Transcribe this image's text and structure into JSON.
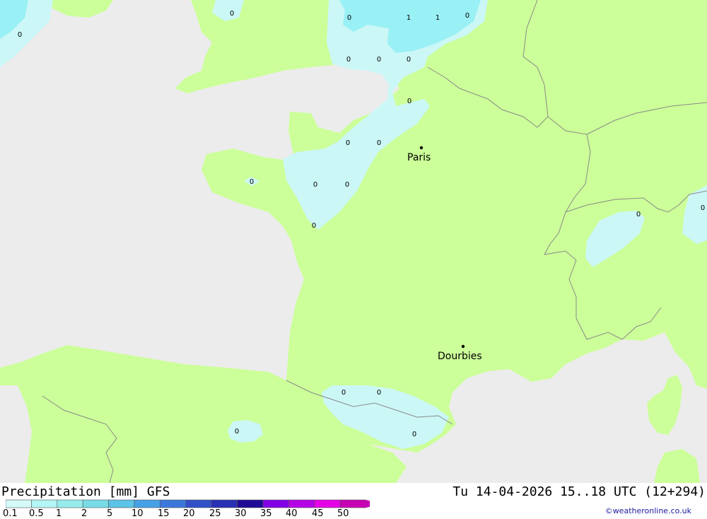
{
  "map": {
    "colors": {
      "sea": "#ececec",
      "land": "#ccff99",
      "precip_light": "#ccf7f7",
      "precip_medium": "#99f0f5",
      "border": "#8a8a8a"
    },
    "cities": [
      {
        "name": "Paris"
      },
      {
        "name": "Dourbies"
      }
    ],
    "precip_values": [
      "0",
      "0",
      "0",
      "1",
      "1",
      "0",
      "0",
      "0",
      "0",
      "0",
      "0",
      "0",
      "0",
      "0",
      "0",
      "0",
      "0",
      "0",
      "0",
      "0",
      "0",
      "0",
      "0"
    ]
  },
  "footer": {
    "title": "Precipitation [mm] GFS",
    "datetime": "Tu 14-04-2026 15..18 UTC (12+294)",
    "credit": "©weatheronline.co.uk"
  },
  "legend": {
    "labels": [
      "0.1",
      "0.5",
      "1",
      "2",
      "5",
      "10",
      "15",
      "20",
      "25",
      "30",
      "35",
      "40",
      "45",
      "50"
    ],
    "colors": [
      "#d4fafa",
      "#b4f5f5",
      "#96ebeb",
      "#78dbe6",
      "#5ac3e6",
      "#46a0e6",
      "#3c78dc",
      "#3250c8",
      "#2830b4",
      "#1e0a96",
      "#8200e6",
      "#b400e6",
      "#e600e6",
      "#c800b4"
    ]
  }
}
